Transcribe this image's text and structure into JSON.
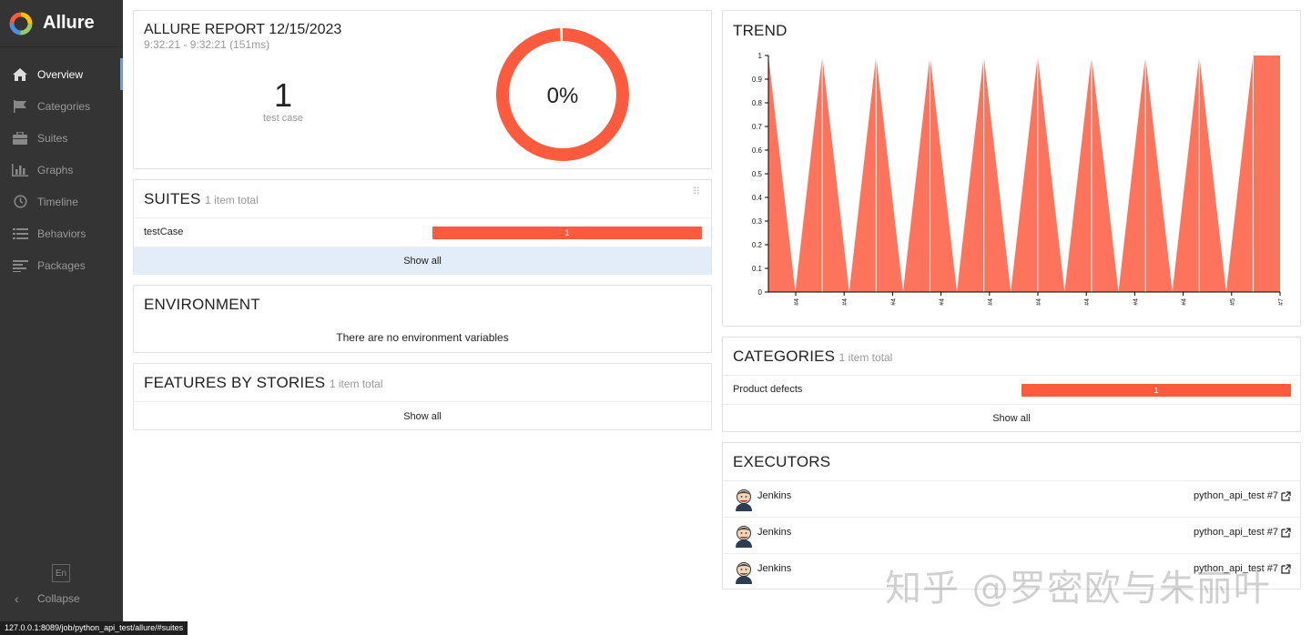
{
  "app": {
    "name": "Allure"
  },
  "sidebar": {
    "items": [
      {
        "label": "Overview",
        "icon": "home-icon",
        "active": true
      },
      {
        "label": "Categories",
        "icon": "flag-icon",
        "active": false
      },
      {
        "label": "Suites",
        "icon": "briefcase-icon",
        "active": false
      },
      {
        "label": "Graphs",
        "icon": "bar-chart-icon",
        "active": false
      },
      {
        "label": "Timeline",
        "icon": "clock-icon",
        "active": false
      },
      {
        "label": "Behaviors",
        "icon": "list-icon",
        "active": false
      },
      {
        "label": "Packages",
        "icon": "align-left-icon",
        "active": false
      }
    ],
    "language": "En",
    "collapse_label": "Collapse"
  },
  "summary": {
    "title": "ALLURE REPORT 12/15/2023",
    "time_range": "9:32:21 - 9:32:21 (151ms)",
    "test_count": "1",
    "test_count_label": "test case",
    "success_rate": "0%"
  },
  "suites": {
    "title": "SUITES",
    "subtitle": "1 item total",
    "rows": [
      {
        "name": "testCase",
        "count": "1"
      }
    ],
    "show_all": "Show all"
  },
  "environment": {
    "title": "ENVIRONMENT",
    "empty_text": "There are no environment variables"
  },
  "features": {
    "title": "FEATURES BY STORIES",
    "subtitle": "1 item total",
    "show_all": "Show all"
  },
  "trend": {
    "title": "TREND"
  },
  "categories": {
    "title": "CATEGORIES",
    "subtitle": "1 item total",
    "rows": [
      {
        "name": "Product defects",
        "count": "1"
      }
    ],
    "show_all": "Show all"
  },
  "executors": {
    "title": "EXECUTORS",
    "rows": [
      {
        "name": "Jenkins",
        "link": "python_api_test #7"
      },
      {
        "name": "Jenkins",
        "link": "python_api_test #7"
      },
      {
        "name": "Jenkins",
        "link": "python_api_test #7"
      }
    ]
  },
  "statusbar": {
    "url": "127.0.0.1:8089/job/python_api_test/allure/#suites"
  },
  "watermark": {
    "text": "知乎 @罗密欧与朱丽叶"
  },
  "colors": {
    "failed": "#fd5a3e",
    "sidebar_bg": "#343434",
    "accent": "#6d9ed5",
    "show_all_hover": "#e3ecf9"
  },
  "chart_data": {
    "type": "area",
    "title": "TREND",
    "x": [
      "#4",
      "#4",
      "#4",
      "#4",
      "#4",
      "#4",
      "#4",
      "#4",
      "#4",
      "#5",
      "#7"
    ],
    "series": [
      {
        "values": [
          1,
          0,
          1,
          0,
          1,
          0,
          1,
          0,
          1,
          0,
          1,
          0,
          1,
          0,
          1,
          0,
          1,
          0,
          1,
          1
        ]
      }
    ],
    "ylim": [
      0,
      1
    ],
    "yticks": [
      "0",
      "0.1",
      "0.2",
      "0.3",
      "0.4",
      "0.5",
      "0.6",
      "0.7",
      "0.8",
      "0.9",
      "1"
    ]
  }
}
